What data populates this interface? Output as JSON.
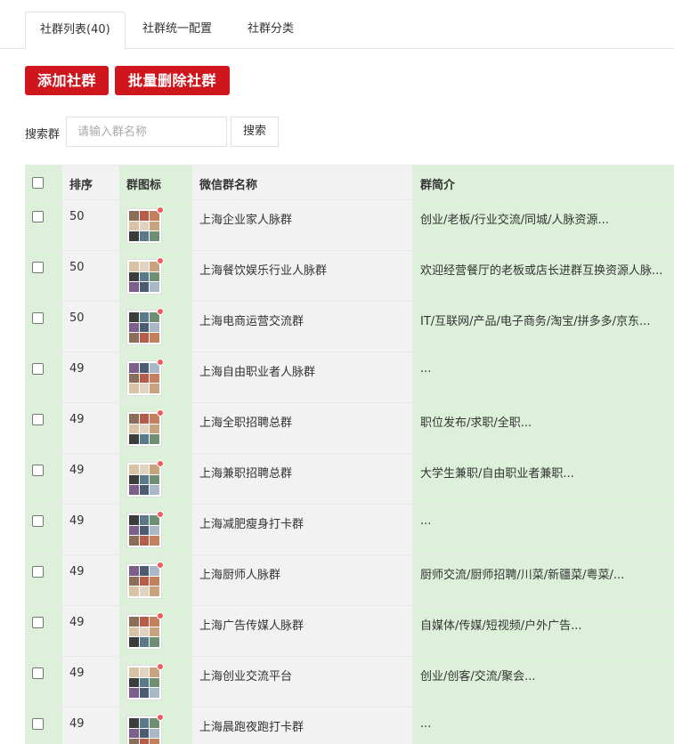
{
  "tabs": [
    {
      "label": "社群列表(40)",
      "active": true
    },
    {
      "label": "社群统一配置",
      "active": false
    },
    {
      "label": "社群分类",
      "active": false
    }
  ],
  "actions": {
    "add_label": "添加社群",
    "batch_delete_label": "批量删除社群"
  },
  "search": {
    "label": "搜索群",
    "placeholder": "请输入群名称",
    "button_label": "搜索"
  },
  "table": {
    "headers": {
      "sort": "排序",
      "icon": "群图标",
      "name": "微信群名称",
      "desc": "群简介"
    },
    "rows": [
      {
        "sort": "50",
        "name": "上海企业家人脉群",
        "desc": "创业/老板/行业交流/同城/人脉资源..."
      },
      {
        "sort": "50",
        "name": "上海餐饮娱乐行业人脉群",
        "desc": "欢迎经营餐厅的老板或店长进群互换资源人脉..."
      },
      {
        "sort": "50",
        "name": "上海电商运营交流群",
        "desc": "IT/互联网/产品/电子商务/淘宝/拼多多/京东..."
      },
      {
        "sort": "49",
        "name": "上海自由职业者人脉群",
        "desc": "..."
      },
      {
        "sort": "49",
        "name": "上海全职招聘总群",
        "desc": "职位发布/求职/全职..."
      },
      {
        "sort": "49",
        "name": "上海兼职招聘总群",
        "desc": "大学生兼职/自由职业者兼职..."
      },
      {
        "sort": "49",
        "name": "上海减肥瘦身打卡群",
        "desc": "..."
      },
      {
        "sort": "49",
        "name": "上海厨师人脉群",
        "desc": "厨师交流/厨师招聘/川菜/新疆菜/粤菜/..."
      },
      {
        "sort": "49",
        "name": "上海广告传媒人脉群",
        "desc": "自媒体/传媒/短视频/户外广告..."
      },
      {
        "sort": "49",
        "name": "上海创业交流平台",
        "desc": "创业/创客/交流/聚会..."
      },
      {
        "sort": "49",
        "name": "上海晨跑夜跑打卡群",
        "desc": "..."
      }
    ]
  },
  "colors": {
    "accent_red": "#d0161d",
    "green_col": "#dcf0da",
    "gray_col": "#f2f2f2",
    "badge_dot": "#f25b5b"
  }
}
